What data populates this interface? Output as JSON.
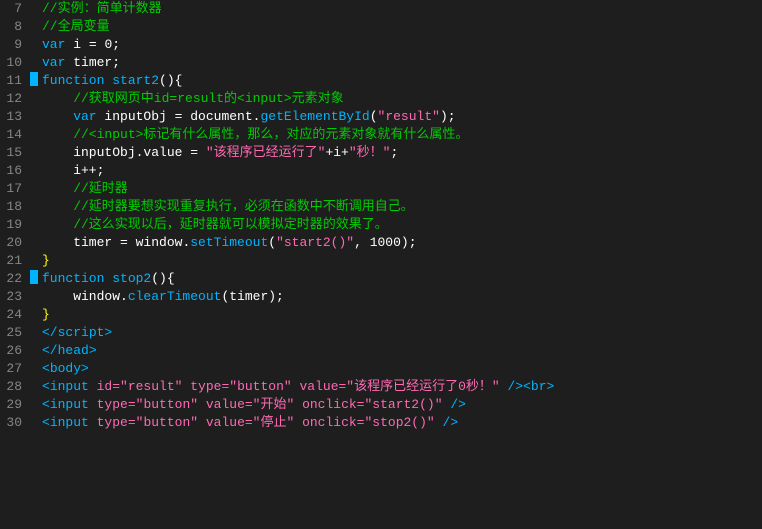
{
  "editor": {
    "background": "#1e1e1e",
    "lines": [
      {
        "num": "7",
        "marker": false,
        "tokens": [
          {
            "text": "//实例：简单计数器",
            "cls": "c-comment"
          }
        ]
      },
      {
        "num": "8",
        "marker": false,
        "tokens": [
          {
            "text": "//全局变量",
            "cls": "c-comment"
          }
        ]
      },
      {
        "num": "9",
        "marker": false,
        "tokens": [
          {
            "text": "var ",
            "cls": "c-keyword"
          },
          {
            "text": "i ",
            "cls": "c-var"
          },
          {
            "text": "= ",
            "cls": "c-punct"
          },
          {
            "text": "0",
            "cls": "c-number"
          },
          {
            "text": ";",
            "cls": "c-punct"
          }
        ]
      },
      {
        "num": "10",
        "marker": false,
        "tokens": [
          {
            "text": "var ",
            "cls": "c-keyword"
          },
          {
            "text": "timer;",
            "cls": "c-var"
          }
        ]
      },
      {
        "num": "11",
        "marker": true,
        "tokens": [
          {
            "text": "function ",
            "cls": "c-keyword"
          },
          {
            "text": "start2",
            "cls": "c-func"
          },
          {
            "text": "(){",
            "cls": "c-paren"
          }
        ]
      },
      {
        "num": "12",
        "marker": false,
        "tokens": [
          {
            "text": "    //获取网页中id=result的<input>元素对象",
            "cls": "c-comment"
          }
        ]
      },
      {
        "num": "13",
        "marker": false,
        "tokens": [
          {
            "text": "    var ",
            "cls": "c-keyword"
          },
          {
            "text": "inputObj ",
            "cls": "c-var"
          },
          {
            "text": "= ",
            "cls": "c-punct"
          },
          {
            "text": "document",
            "cls": "c-obj"
          },
          {
            "text": ".",
            "cls": "c-punct"
          },
          {
            "text": "getElementById",
            "cls": "c-func"
          },
          {
            "text": "(",
            "cls": "c-paren"
          },
          {
            "text": "\"result\"",
            "cls": "c-string"
          },
          {
            "text": ");",
            "cls": "c-paren"
          }
        ]
      },
      {
        "num": "14",
        "marker": false,
        "tokens": [
          {
            "text": "    //<input>标记有什么属性，那么，对应的元素对象就有什么属性。",
            "cls": "c-comment"
          }
        ]
      },
      {
        "num": "15",
        "marker": false,
        "tokens": [
          {
            "text": "    inputObj",
            "cls": "c-var"
          },
          {
            "text": ".value ",
            "cls": "c-method"
          },
          {
            "text": "= ",
            "cls": "c-punct"
          },
          {
            "text": "\"该程序已经运行了\"",
            "cls": "c-string"
          },
          {
            "text": "+i+",
            "cls": "c-punct"
          },
          {
            "text": "\"秒！\"",
            "cls": "c-string"
          },
          {
            "text": ";",
            "cls": "c-punct"
          }
        ]
      },
      {
        "num": "16",
        "marker": false,
        "tokens": [
          {
            "text": "    i++;",
            "cls": "c-var"
          }
        ]
      },
      {
        "num": "17",
        "marker": false,
        "tokens": [
          {
            "text": "    //延时器",
            "cls": "c-comment"
          }
        ]
      },
      {
        "num": "18",
        "marker": false,
        "tokens": [
          {
            "text": "    //延时器要想实现重复执行，必须在函数中不断调用自己。",
            "cls": "c-comment"
          }
        ]
      },
      {
        "num": "19",
        "marker": false,
        "tokens": [
          {
            "text": "    //这么实现以后，延时器就可以模拟定时器的效果了。",
            "cls": "c-comment"
          }
        ]
      },
      {
        "num": "20",
        "marker": false,
        "tokens": [
          {
            "text": "    timer ",
            "cls": "c-var"
          },
          {
            "text": "= ",
            "cls": "c-punct"
          },
          {
            "text": "window",
            "cls": "c-obj"
          },
          {
            "text": ".",
            "cls": "c-punct"
          },
          {
            "text": "setTimeout",
            "cls": "c-func"
          },
          {
            "text": "(",
            "cls": "c-paren"
          },
          {
            "text": "\"start2()\"",
            "cls": "c-string"
          },
          {
            "text": ", ",
            "cls": "c-punct"
          },
          {
            "text": "1000",
            "cls": "c-number"
          },
          {
            "text": ");",
            "cls": "c-punct"
          }
        ]
      },
      {
        "num": "21",
        "marker": false,
        "tokens": [
          {
            "text": "}",
            "cls": "c-brace"
          }
        ]
      },
      {
        "num": "22",
        "marker": true,
        "tokens": [
          {
            "text": "function ",
            "cls": "c-keyword"
          },
          {
            "text": "stop2",
            "cls": "c-func"
          },
          {
            "text": "(){",
            "cls": "c-paren"
          }
        ]
      },
      {
        "num": "23",
        "marker": false,
        "tokens": [
          {
            "text": "    window",
            "cls": "c-obj"
          },
          {
            "text": ".",
            "cls": "c-punct"
          },
          {
            "text": "clearTimeout",
            "cls": "c-func"
          },
          {
            "text": "(timer);",
            "cls": "c-paren"
          }
        ]
      },
      {
        "num": "24",
        "marker": false,
        "tokens": [
          {
            "text": "}",
            "cls": "c-brace"
          }
        ]
      },
      {
        "num": "25",
        "marker": false,
        "tokens": [
          {
            "text": "</",
            "cls": "c-tag"
          },
          {
            "text": "script",
            "cls": "c-tag"
          },
          {
            "text": ">",
            "cls": "c-tag"
          }
        ]
      },
      {
        "num": "26",
        "marker": false,
        "tokens": [
          {
            "text": "</",
            "cls": "c-tag"
          },
          {
            "text": "head",
            "cls": "c-tag"
          },
          {
            "text": ">",
            "cls": "c-tag"
          }
        ]
      },
      {
        "num": "27",
        "marker": false,
        "tokens": [
          {
            "text": "<",
            "cls": "c-tag"
          },
          {
            "text": "body",
            "cls": "c-tag"
          },
          {
            "text": ">",
            "cls": "c-tag"
          }
        ]
      },
      {
        "num": "28",
        "marker": false,
        "tokens": [
          {
            "text": "<",
            "cls": "c-tag"
          },
          {
            "text": "input ",
            "cls": "c-tag"
          },
          {
            "text": "id=",
            "cls": "c-attr"
          },
          {
            "text": "\"result\" ",
            "cls": "c-value"
          },
          {
            "text": "type=",
            "cls": "c-attr"
          },
          {
            "text": "\"button\" ",
            "cls": "c-value"
          },
          {
            "text": "value=",
            "cls": "c-attr"
          },
          {
            "text": "\"该程序已经运行了0秒！\" ",
            "cls": "c-value"
          },
          {
            "text": "/>",
            "cls": "c-tag"
          },
          {
            "text": "<br>",
            "cls": "c-tag"
          }
        ]
      },
      {
        "num": "29",
        "marker": false,
        "tokens": [
          {
            "text": "<",
            "cls": "c-tag"
          },
          {
            "text": "input ",
            "cls": "c-tag"
          },
          {
            "text": "type=",
            "cls": "c-attr"
          },
          {
            "text": "\"button\" ",
            "cls": "c-value"
          },
          {
            "text": "value=",
            "cls": "c-attr"
          },
          {
            "text": "\"开始\" ",
            "cls": "c-value"
          },
          {
            "text": "onclick=",
            "cls": "c-attr"
          },
          {
            "text": "\"start2()\" ",
            "cls": "c-value"
          },
          {
            "text": "/>",
            "cls": "c-tag"
          }
        ]
      },
      {
        "num": "30",
        "marker": false,
        "tokens": [
          {
            "text": "<",
            "cls": "c-tag"
          },
          {
            "text": "input ",
            "cls": "c-tag"
          },
          {
            "text": "type=",
            "cls": "c-attr"
          },
          {
            "text": "\"button\" ",
            "cls": "c-value"
          },
          {
            "text": "value=",
            "cls": "c-attr"
          },
          {
            "text": "\"停止\" ",
            "cls": "c-value"
          },
          {
            "text": "onclick=",
            "cls": "c-attr"
          },
          {
            "text": "\"stop2()\" ",
            "cls": "c-value"
          },
          {
            "text": "/>",
            "cls": "c-tag"
          }
        ]
      }
    ]
  }
}
